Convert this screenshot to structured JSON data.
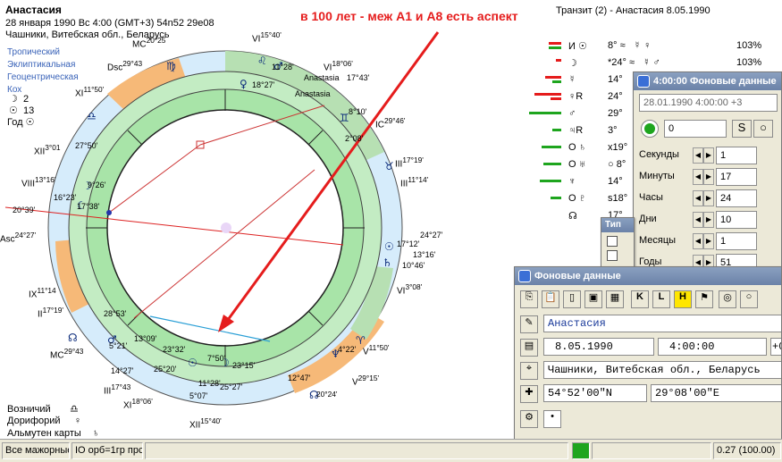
{
  "chart": {
    "name": "Анастасия",
    "line1": "28 января 1990  Вс    4:00 (GMT+3)  54n52  29e08",
    "line2": "Чашники, Витебская обл., Беларусь",
    "system": [
      "Тропический",
      "Эклиптикальная",
      "Геоцентрическая",
      "Кох"
    ],
    "counts": [
      {
        "icon": "moon-icon",
        "glyph": "☽",
        "value": "2"
      },
      {
        "icon": "sun-icon",
        "glyph": "☉",
        "value": "13"
      }
    ],
    "year_label": "Год",
    "year_glyph": "☉",
    "annotation": "в 100 лет - меж А1 и А8 есть аспект",
    "transit_title": "Транзит (2) - Анастасия  8.05.1990",
    "wheel_labels": [
      {
        "t": "MC",
        "sup": "20°25"
      },
      {
        "t": "Dsc",
        "sup": "29°43"
      },
      {
        "t": "XI",
        "sup": "11°50'"
      },
      {
        "t": "XII",
        "sup": "3°01"
      },
      {
        "t": "VIII",
        "sup": "13°16'"
      },
      {
        "t": "Asc",
        "sup": "24°27'"
      },
      {
        "t": "IX",
        "sup": "11°14"
      },
      {
        "t": "II",
        "sup": "17°19'"
      },
      {
        "t": "MC",
        "sup": "29°43"
      },
      {
        "t": "III",
        "sup": "17°43"
      },
      {
        "t": "XI",
        "sup": "18°06'"
      },
      {
        "t": "XII",
        "sup": "15°40'"
      },
      {
        "t": "VI",
        "sup": "15°40'"
      },
      {
        "t": "VI",
        "sup": "18°06'"
      },
      {
        "t": "IC",
        "sup": "29°46'"
      },
      {
        "t": "III",
        "sup": "17°19'"
      },
      {
        "t": "III",
        "sup": "11°14'"
      },
      {
        "t": "VI",
        "sup": "3°08'"
      },
      {
        "t": "V",
        "sup": "11°50'"
      },
      {
        "t": "V",
        "sup": "29°15'"
      },
      {
        "t": "",
        "sup": "20°24'"
      }
    ],
    "inner_labels": [
      "11°28'",
      "18°27'",
      "Anastasia",
      "Anastasia",
      "17°43'",
      "8°10'",
      "2°08'",
      "27°50'",
      "9°26'",
      "16°23'",
      "17°38'",
      "20°39'",
      "24°27'",
      "17°12'",
      "13°16'",
      "10°46'",
      "28°53'",
      "13°09'",
      "23°32'",
      "7°50'",
      "23°15'",
      "4°22'",
      "5°21'",
      "14°27'",
      "25°20'",
      "11°28'",
      "25°27'",
      "12°47'",
      "5°07'"
    ]
  },
  "planets": [
    {
      "planet": "☉",
      "icon": "sun-icon",
      "mark": "И",
      "deg": "8°",
      "sign": "≈",
      "extra": "☿ ♀",
      "pct": "103%"
    },
    {
      "planet": "☽",
      "icon": "moon-icon",
      "mark": "",
      "deg": "*24°",
      "sign": "≈",
      "extra": "☿ ♂",
      "pct": "103%"
    },
    {
      "planet": "☿",
      "icon": "mercury-icon",
      "mark": "",
      "deg": "14°",
      "sign": "",
      "extra": "",
      "pct": ""
    },
    {
      "planet": "♀R",
      "icon": "venus-icon",
      "mark": "",
      "deg": "24°",
      "sign": "",
      "extra": "",
      "pct": ""
    },
    {
      "planet": "♂",
      "icon": "mars-icon",
      "mark": "",
      "deg": "29°",
      "sign": "",
      "extra": "",
      "pct": ""
    },
    {
      "planet": "♃R",
      "icon": "jupiter-icon",
      "mark": "",
      "deg": "3°",
      "sign": "",
      "extra": "",
      "pct": ""
    },
    {
      "planet": "♄",
      "icon": "saturn-icon",
      "mark": "О",
      "deg": "x19°",
      "sign": "",
      "extra": "",
      "pct": ""
    },
    {
      "planet": "♅",
      "icon": "uranus-icon",
      "mark": "О",
      "deg": "○ 8°",
      "sign": "",
      "extra": "",
      "pct": ""
    },
    {
      "planet": "♆",
      "icon": "neptune-icon",
      "mark": "",
      "deg": "14°",
      "sign": "",
      "extra": "",
      "pct": ""
    },
    {
      "planet": "♇",
      "icon": "pluto-icon",
      "mark": "О",
      "deg": "s18°",
      "sign": "",
      "extra": "",
      "pct": ""
    },
    {
      "planet": "☊",
      "icon": "node-icon",
      "mark": "",
      "deg": "17°",
      "sign": "",
      "extra": "",
      "pct": ""
    }
  ],
  "bottom_notes": [
    {
      "label": "Возничий",
      "glyph": "♎",
      "icon": "libra-icon"
    },
    {
      "label": "Дорифорий",
      "glyph": "♀",
      "icon": "venus-icon"
    },
    {
      "label": "Альмутен карты",
      "glyph": "♄",
      "icon": "saturn-icon"
    }
  ],
  "time_window": {
    "title": "4:00:00 Фоновые данные",
    "date": "28.01.1990  4:00:00  +3",
    "field0": "0",
    "rows": [
      {
        "label": "Секунды",
        "value": "1"
      },
      {
        "label": "Минуты",
        "value": "17"
      },
      {
        "label": "Часы",
        "value": "24"
      },
      {
        "label": "Дни",
        "value": "10"
      },
      {
        "label": "Месяцы",
        "value": "1"
      },
      {
        "label": "Годы",
        "value": "51"
      }
    ],
    "type_label": "Тип"
  },
  "bg_window": {
    "title": "Фоновые данные",
    "name": "Анастасия",
    "date": "8.05.1990",
    "time": "4:00:00",
    "tz": "+0",
    "place": "Чашники, Витебская обл., Беларусь",
    "lat": "54°52'00\"N",
    "lon": "29°08'00\"E"
  },
  "status_bar": {
    "left": "Все мажорные",
    "mid": "IO орб=1гр прс",
    "right": "0.27 (100.00)"
  },
  "colors": {
    "green": "#8fd68f",
    "ring_dark": "#3a3a3a",
    "annotation": "#e51c1c",
    "blue": "#3a63b8"
  }
}
